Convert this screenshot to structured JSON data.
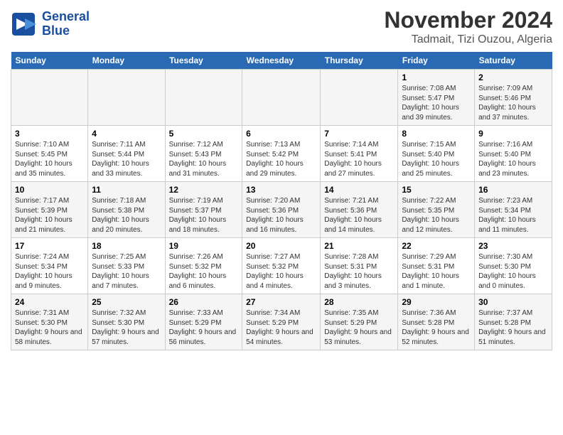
{
  "header": {
    "logo_line1": "General",
    "logo_line2": "Blue",
    "month": "November 2024",
    "location": "Tadmait, Tizi Ouzou, Algeria"
  },
  "days_of_week": [
    "Sunday",
    "Monday",
    "Tuesday",
    "Wednesday",
    "Thursday",
    "Friday",
    "Saturday"
  ],
  "weeks": [
    [
      {
        "day": "",
        "info": ""
      },
      {
        "day": "",
        "info": ""
      },
      {
        "day": "",
        "info": ""
      },
      {
        "day": "",
        "info": ""
      },
      {
        "day": "",
        "info": ""
      },
      {
        "day": "1",
        "info": "Sunrise: 7:08 AM\nSunset: 5:47 PM\nDaylight: 10 hours and 39 minutes."
      },
      {
        "day": "2",
        "info": "Sunrise: 7:09 AM\nSunset: 5:46 PM\nDaylight: 10 hours and 37 minutes."
      }
    ],
    [
      {
        "day": "3",
        "info": "Sunrise: 7:10 AM\nSunset: 5:45 PM\nDaylight: 10 hours and 35 minutes."
      },
      {
        "day": "4",
        "info": "Sunrise: 7:11 AM\nSunset: 5:44 PM\nDaylight: 10 hours and 33 minutes."
      },
      {
        "day": "5",
        "info": "Sunrise: 7:12 AM\nSunset: 5:43 PM\nDaylight: 10 hours and 31 minutes."
      },
      {
        "day": "6",
        "info": "Sunrise: 7:13 AM\nSunset: 5:42 PM\nDaylight: 10 hours and 29 minutes."
      },
      {
        "day": "7",
        "info": "Sunrise: 7:14 AM\nSunset: 5:41 PM\nDaylight: 10 hours and 27 minutes."
      },
      {
        "day": "8",
        "info": "Sunrise: 7:15 AM\nSunset: 5:40 PM\nDaylight: 10 hours and 25 minutes."
      },
      {
        "day": "9",
        "info": "Sunrise: 7:16 AM\nSunset: 5:40 PM\nDaylight: 10 hours and 23 minutes."
      }
    ],
    [
      {
        "day": "10",
        "info": "Sunrise: 7:17 AM\nSunset: 5:39 PM\nDaylight: 10 hours and 21 minutes."
      },
      {
        "day": "11",
        "info": "Sunrise: 7:18 AM\nSunset: 5:38 PM\nDaylight: 10 hours and 20 minutes."
      },
      {
        "day": "12",
        "info": "Sunrise: 7:19 AM\nSunset: 5:37 PM\nDaylight: 10 hours and 18 minutes."
      },
      {
        "day": "13",
        "info": "Sunrise: 7:20 AM\nSunset: 5:36 PM\nDaylight: 10 hours and 16 minutes."
      },
      {
        "day": "14",
        "info": "Sunrise: 7:21 AM\nSunset: 5:36 PM\nDaylight: 10 hours and 14 minutes."
      },
      {
        "day": "15",
        "info": "Sunrise: 7:22 AM\nSunset: 5:35 PM\nDaylight: 10 hours and 12 minutes."
      },
      {
        "day": "16",
        "info": "Sunrise: 7:23 AM\nSunset: 5:34 PM\nDaylight: 10 hours and 11 minutes."
      }
    ],
    [
      {
        "day": "17",
        "info": "Sunrise: 7:24 AM\nSunset: 5:34 PM\nDaylight: 10 hours and 9 minutes."
      },
      {
        "day": "18",
        "info": "Sunrise: 7:25 AM\nSunset: 5:33 PM\nDaylight: 10 hours and 7 minutes."
      },
      {
        "day": "19",
        "info": "Sunrise: 7:26 AM\nSunset: 5:32 PM\nDaylight: 10 hours and 6 minutes."
      },
      {
        "day": "20",
        "info": "Sunrise: 7:27 AM\nSunset: 5:32 PM\nDaylight: 10 hours and 4 minutes."
      },
      {
        "day": "21",
        "info": "Sunrise: 7:28 AM\nSunset: 5:31 PM\nDaylight: 10 hours and 3 minutes."
      },
      {
        "day": "22",
        "info": "Sunrise: 7:29 AM\nSunset: 5:31 PM\nDaylight: 10 hours and 1 minute."
      },
      {
        "day": "23",
        "info": "Sunrise: 7:30 AM\nSunset: 5:30 PM\nDaylight: 10 hours and 0 minutes."
      }
    ],
    [
      {
        "day": "24",
        "info": "Sunrise: 7:31 AM\nSunset: 5:30 PM\nDaylight: 9 hours and 58 minutes."
      },
      {
        "day": "25",
        "info": "Sunrise: 7:32 AM\nSunset: 5:30 PM\nDaylight: 9 hours and 57 minutes."
      },
      {
        "day": "26",
        "info": "Sunrise: 7:33 AM\nSunset: 5:29 PM\nDaylight: 9 hours and 56 minutes."
      },
      {
        "day": "27",
        "info": "Sunrise: 7:34 AM\nSunset: 5:29 PM\nDaylight: 9 hours and 54 minutes."
      },
      {
        "day": "28",
        "info": "Sunrise: 7:35 AM\nSunset: 5:29 PM\nDaylight: 9 hours and 53 minutes."
      },
      {
        "day": "29",
        "info": "Sunrise: 7:36 AM\nSunset: 5:28 PM\nDaylight: 9 hours and 52 minutes."
      },
      {
        "day": "30",
        "info": "Sunrise: 7:37 AM\nSunset: 5:28 PM\nDaylight: 9 hours and 51 minutes."
      }
    ]
  ]
}
